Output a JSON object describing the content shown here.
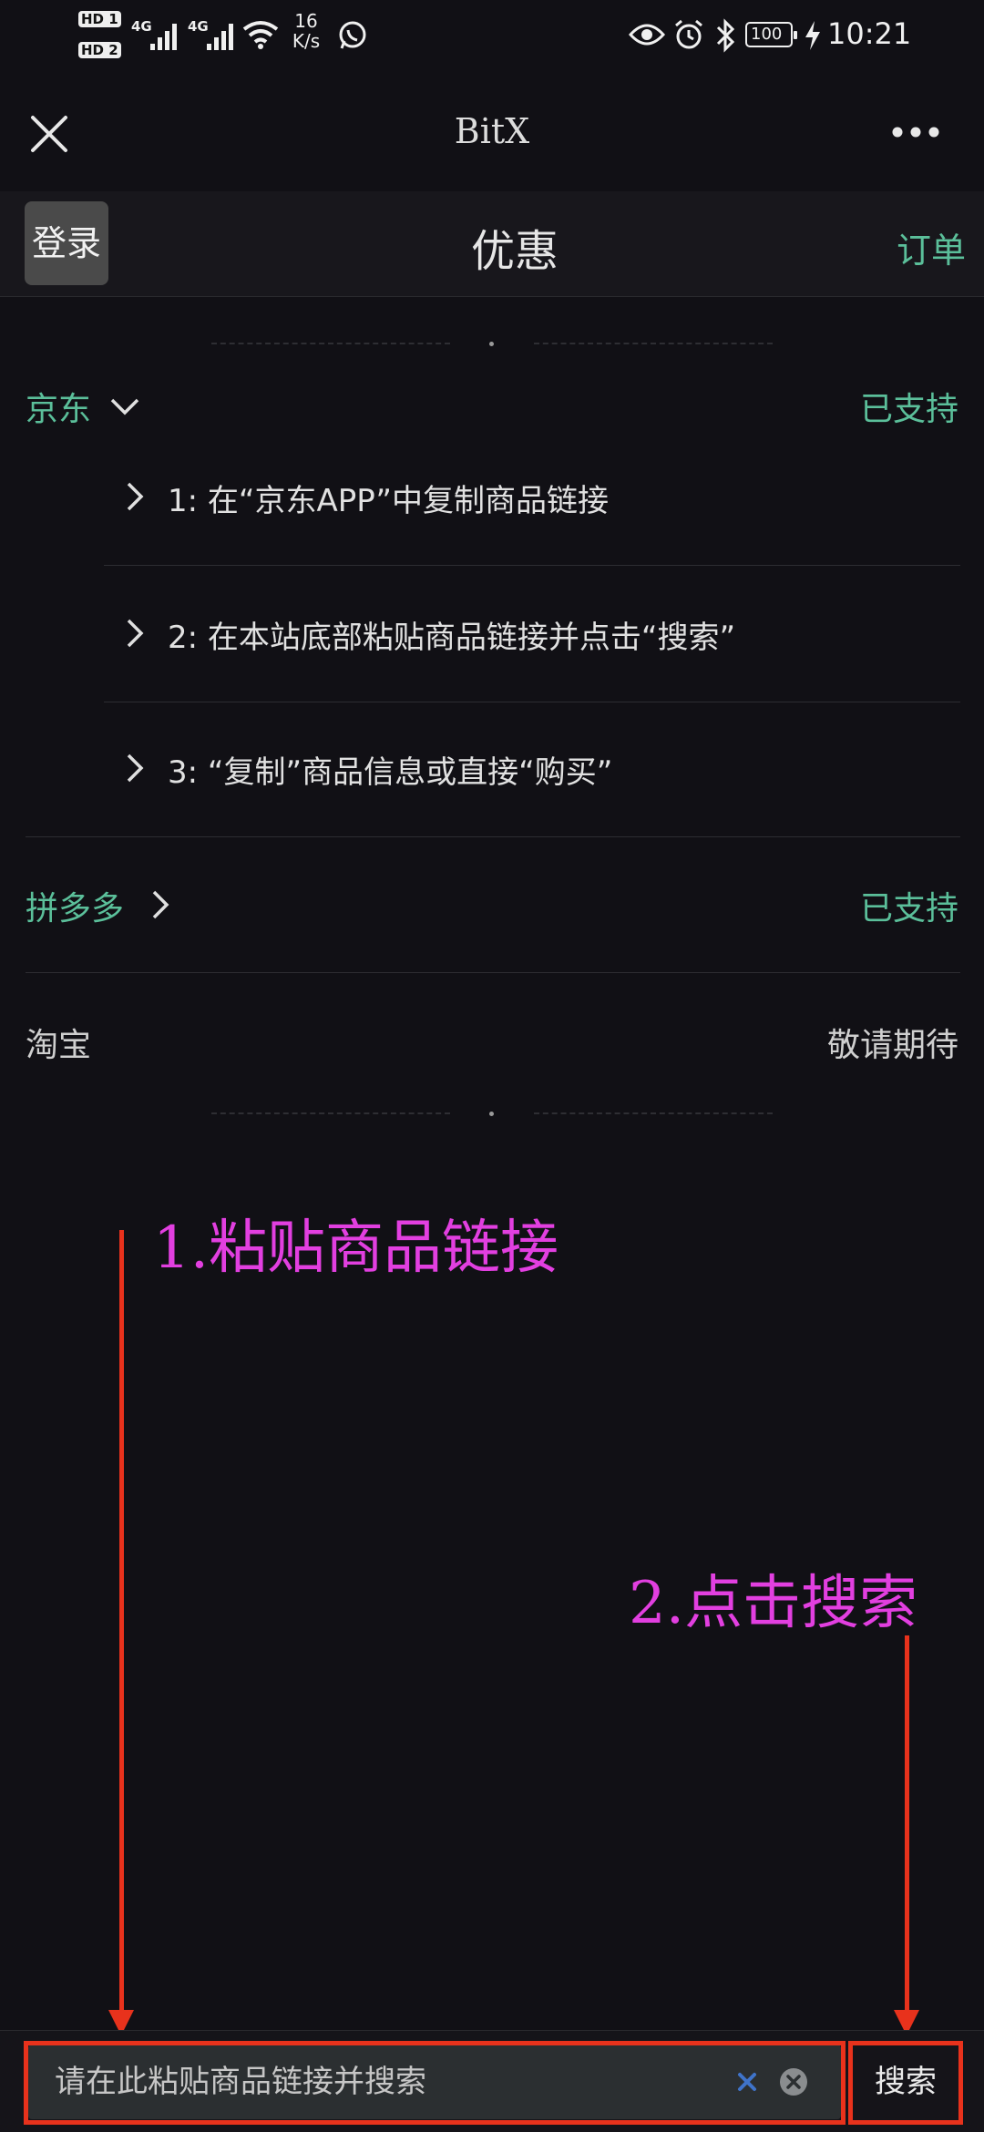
{
  "status_bar": {
    "time": "10:21",
    "net_speed_value": "16",
    "net_speed_unit": "K/s",
    "battery": "100",
    "sim1": "HD 1",
    "sim2": "HD 2",
    "network1": "4G",
    "network2": "4G"
  },
  "title_bar": {
    "title": "BitX",
    "close_icon": "close-icon",
    "more_icon": "more-icon"
  },
  "header": {
    "login": "登录",
    "title": "优惠",
    "orders": "订单"
  },
  "platforms": [
    {
      "name": "京东",
      "status": "已支持",
      "expanded": true,
      "steps": [
        "1: 在“京东APP”中复制商品链接",
        "2: 在本站底部粘贴商品链接并点击“搜索”",
        "3: “复制”商品信息或直接“购买”"
      ]
    },
    {
      "name": "拼多多",
      "status": "已支持",
      "expanded": false
    },
    {
      "name": "淘宝",
      "status": "敬请期待",
      "expanded": false
    }
  ],
  "annotations": {
    "step1": "1.粘贴商品链接",
    "step2": "2.点击搜索"
  },
  "search": {
    "placeholder": "请在此粘贴商品链接并搜索",
    "value": "",
    "button": "搜索"
  },
  "colors": {
    "background": "#111015",
    "accent_green": "#5bbf9a",
    "annotation_magenta": "#e23fe0",
    "annotation_red": "#e8321c"
  }
}
